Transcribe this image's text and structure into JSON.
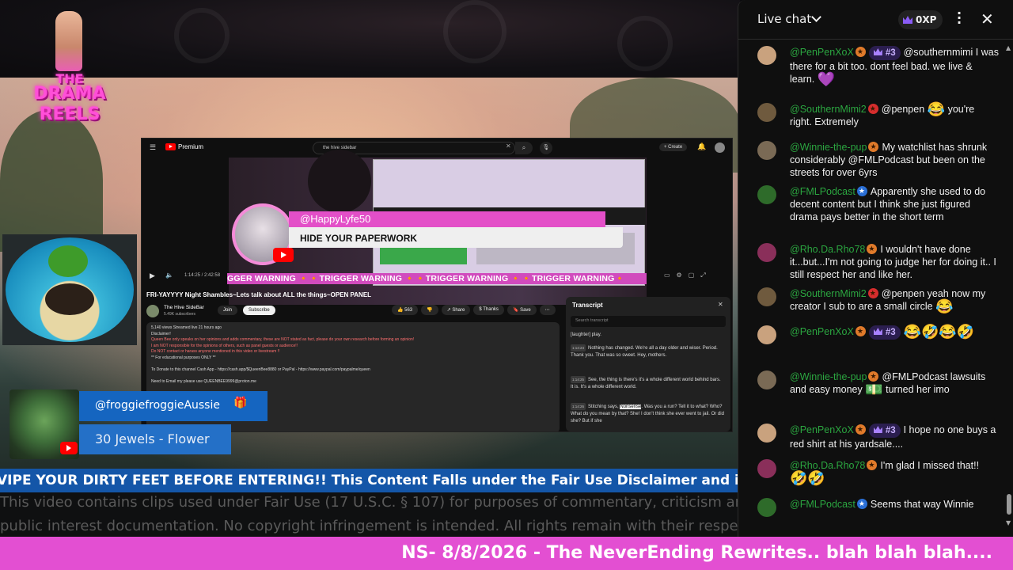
{
  "logo": {
    "line1": "THE",
    "line2": "DRAMA",
    "line3": "REELS"
  },
  "browser": {
    "brand": "Premium",
    "search_value": "the hive sidebar",
    "create_label": "Create",
    "time": "1:14:25 / 2:42:58",
    "trigger_text": "GGER WARNING 🔸🔸TRIGGER WARNING 🔸🔸TRIGGER WARNING 🔸🔸TRIGGER WARNING🔸",
    "overlay_user": "@HappyLyfe50",
    "overlay_message": "HIDE YOUR PAPERWORK",
    "video_title": "FRI-YAYYYY Night Shambles~Lets talk about ALL the things~OPEN PANEL",
    "channel_name": "The Hive SideBar",
    "channel_subs": "5.49K subscribers",
    "join_label": "Join",
    "subscribe_label": "Subscribe",
    "actions": [
      "👍 563",
      "👎",
      "↗ Share",
      "$ Thanks",
      "🔖 Save",
      "⋯"
    ],
    "description_lines": [
      "5,140 views  Streamed live 21 hours ago",
      "Disclaimer!",
      "Queen Bee only speaks on her opinions and adds commentary, these are NOT stated as fact, please do your own research before forming an opinion!",
      "I am NOT responsible for the opinions of others, such as panel guests or audience!!",
      "Do NOT contact or harass anyone mentioned in this video or livestream !!",
      "** For educational purposes ONLY **",
      "",
      "To Donate to this channel Cash App - https://cash.app/$QueenBee8880 or PayPal - https://www.paypal.com/paypalme/queen",
      "",
      "Need to Email my please use QUEENBEE9999@proton.me"
    ],
    "transcript": {
      "title": "Transcript",
      "search_placeholder": "Search transcript",
      "lines": [
        {
          "ts": "",
          "text": "[laughter] play."
        },
        {
          "ts": "1:14:24",
          "text": "Nothing has changed. We're all a day older and wiser. Period. Thank you. That was so sweet. Hey, mothers."
        },
        {
          "ts": "1:14:25",
          "text": "See, the thing is there's it's a whole different world behind bars. It is. It's a whole different world."
        },
        {
          "ts": "1:14:26",
          "text": "Stitching says, Nonsense. Was you a run? Tell it to what? Who? What do you mean by that? She! I don't think she ever went to jail. Or did she? But if she"
        }
      ]
    }
  },
  "gift": {
    "user": "@froggiefroggieAussie",
    "amount": "30 Jewels - Flower"
  },
  "ticker": "VIPE YOUR DIRTY FEET BEFORE ENTERING!! This Content Falls under the Fair Use Disclaimer and is for edu",
  "disclaimer": {
    "line1": "This video contains clips used under Fair Use (17 U.S.C. § 107) for purposes of commentary, criticism and",
    "line2": "public interest documentation. No copyright infringement is intended. All rights remain with their respective"
  },
  "bottom_bar": "NS- 8/8/2026 - The NeverEnding Rewrites.. blah blah blah....",
  "chat": {
    "title": "Live chat",
    "xp": "0XP",
    "messages": [
      {
        "author": "@PenPenXoX",
        "badge": "mod",
        "rank": "#3",
        "text": "@southernmimi I was there for a bit too. dont feel bad. we live & learn.",
        "emoji": "💜",
        "avatar_color": "#c9a27e"
      },
      {
        "author": "@SouthernMimi2",
        "badge": "red",
        "rank": "",
        "text": "@penpen",
        "emoji": "😂",
        "text2": "you're right. Extremely",
        "avatar_color": "#6f5a3e"
      },
      {
        "author": "@Winnie-the-pup",
        "badge": "mod",
        "rank": "",
        "text": "My watchlist has shrunk considerably @FMLPodcast but been on the streets for over 6yrs",
        "emoji": "",
        "avatar_color": "#7a6a55"
      },
      {
        "author": "@FMLPodcast",
        "badge": "blue",
        "rank": "",
        "text": "Apparently she used to do decent content but I think she just figured drama pays better in the short term",
        "emoji": "",
        "avatar_color": "#2e6b2a"
      },
      {
        "author": "@Rho.Da.Rho78",
        "badge": "mod",
        "rank": "",
        "text": "I wouldn't have done it...but...I'm not going to judge her for doing it.. I still respect her and like her.",
        "emoji": "",
        "avatar_color": "#8a2f5a"
      },
      {
        "author": "@SouthernMimi2",
        "badge": "red",
        "rank": "",
        "text": "@penpen yeah now my creator I sub to are a small circle",
        "emoji": "😂",
        "avatar_color": "#6f5a3e"
      },
      {
        "author": "@PenPenXoX",
        "badge": "mod",
        "rank": "#3",
        "text": "",
        "emoji": "😂🤣😂🤣",
        "avatar_color": "#c9a27e"
      },
      {
        "author": "@Winnie-the-pup",
        "badge": "mod",
        "rank": "",
        "text": "@FMLPodcast lawsuits and easy money",
        "emoji": "💵",
        "text2": "turned her imo",
        "avatar_color": "#7a6a55"
      },
      {
        "author": "@PenPenXoX",
        "badge": "mod",
        "rank": "#3",
        "text": "I hope no one buys a red shirt at his yardsale....",
        "emoji": "",
        "avatar_color": "#c9a27e"
      },
      {
        "author": "@Rho.Da.Rho78",
        "badge": "mod",
        "rank": "",
        "text": "I'm glad I missed that!!",
        "emoji": "🤣🤣",
        "avatar_color": "#8a2f5a"
      },
      {
        "author": "@FMLPodcast",
        "badge": "blue",
        "rank": "",
        "text": "Seems that way Winnie",
        "emoji": "",
        "avatar_color": "#2e6b2a"
      }
    ]
  }
}
